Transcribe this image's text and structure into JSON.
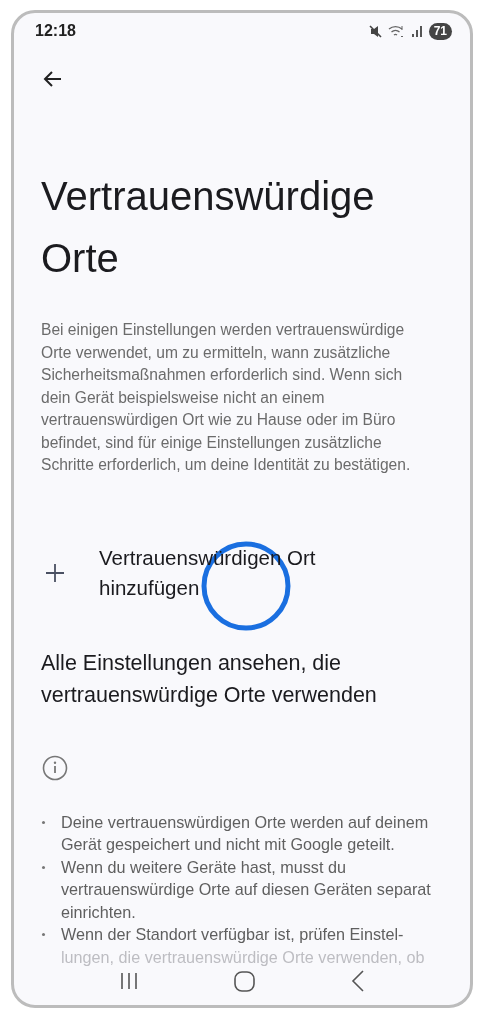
{
  "status_bar": {
    "time": "12:18",
    "battery": "71"
  },
  "title": "Vertrauenswürdige Orte",
  "description": "Bei einigen Einstellungen werden vertrauenswürdige Orte verwendet, um zu ermitteln, wann zusätzliche Sicherheitsmaßnahmen erforderlich sind. Wenn sich dein Gerät beispielsweise nicht an einem vertrauenswürdigen Ort wie zu Hause oder im Büro befindet, sind für einige Einstellungen zusätzliche Schritte erforderlich, um deine Identität zu bestätigen.",
  "add_action": {
    "label": "Vertrauenswürdigen Ort hinzufügen"
  },
  "settings_link": "Alle Einstellungen ansehen, die vertrauenswürdige Orte verwenden",
  "info_bullets": [
    {
      "text": "Deine vertrauenswürdigen Orte werden auf deinem Gerät gespeichert und nicht mit Google geteilt."
    },
    {
      "text": "Wenn du weitere Geräte hast, musst du vertrauenswürdige Orte auf diesen Geräten separat einrichten."
    },
    {
      "text": "Wenn der Standort verfügbar ist, prüfen Einstel-",
      "faded_lines": [
        "lungen, die vertrauenswürdige Orte verwenden, ob"
      ]
    }
  ],
  "touch_indicator": true
}
